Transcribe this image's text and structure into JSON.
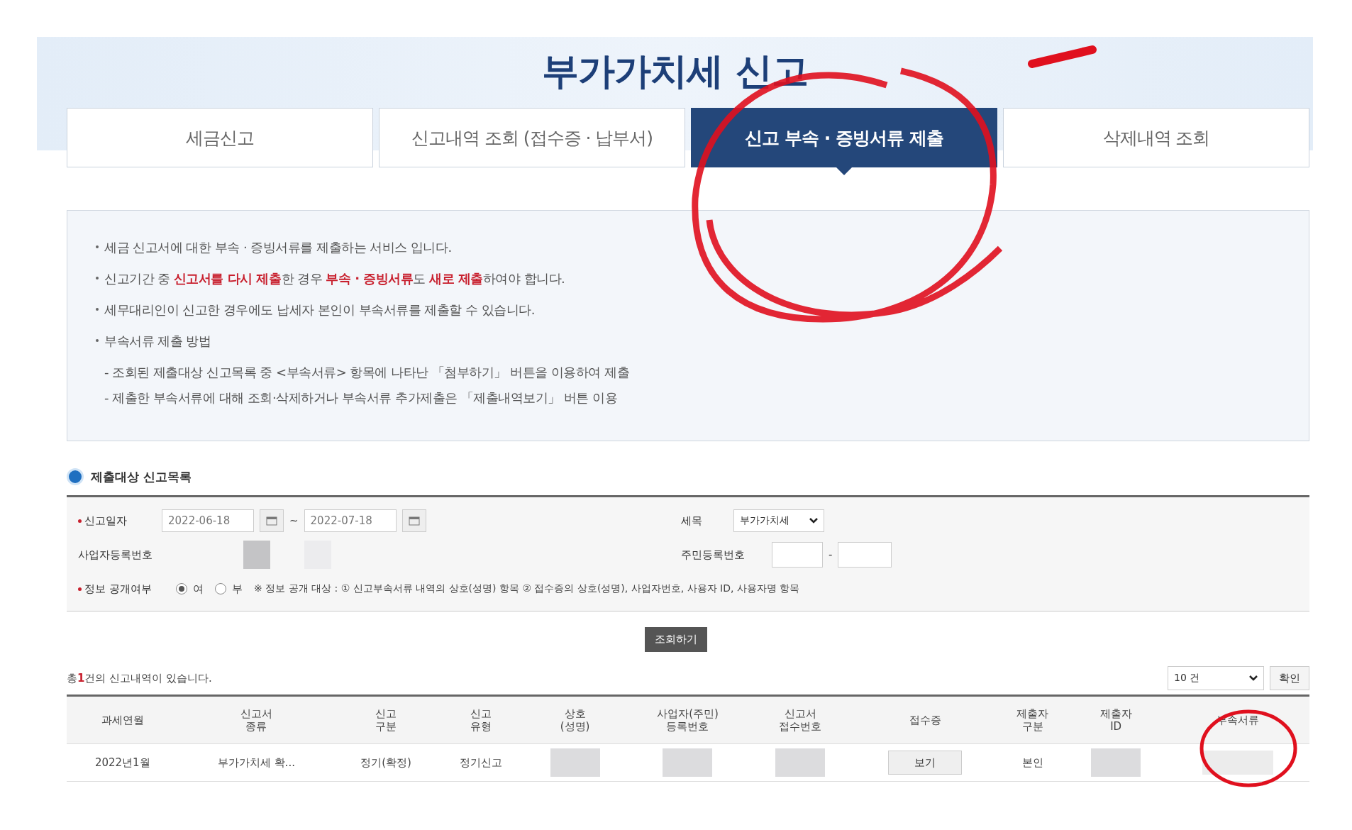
{
  "header": {
    "title": "부가가치세 신고"
  },
  "tabs": [
    {
      "label": "세금신고",
      "selected": false
    },
    {
      "label": "신고내역 조회 (접수증 · 납부서)",
      "selected": false
    },
    {
      "label": "신고 부속 · 증빙서류 제출",
      "selected": true
    },
    {
      "label": "삭제내역 조회",
      "selected": false
    }
  ],
  "notice": {
    "items": [
      "세금 신고서에 대한 부속 · 증빙서류를 제출하는 서비스 입니다.",
      "신고기간 중 **신고서를 다시 제출**한 경우 **부속 · 증빙서류**도 **새로 제출**하여야 합니다.",
      "세무대리인이 신고한 경우에도 납세자 본인이 부속서류를 제출할 수 있습니다.",
      "부속서류 제출 방법"
    ],
    "sub_items": [
      "- 조회된 제출대상 신고목록 중 <부속서류> 항목에 나타난 「첨부하기」 버튼을 이용하여 제출",
      "- 제출한 부속서류에 대해 조회·삭제하거나 부속서류 추가제출은 「제출내역보기」 버튼 이용"
    ]
  },
  "section_title": "제출대상 신고목록",
  "search": {
    "date_label": "신고일자",
    "date_from": "2022-06-18",
    "date_sep": "~",
    "date_to": "2022-07-18",
    "tax_label": "세목",
    "tax_value": "부가가치세",
    "biz_label": "사업자등록번호",
    "rrn_label": "주민등록번호",
    "rrn_sep": "-",
    "public_label": "정보 공개여부",
    "public_options": [
      {
        "label": "여",
        "selected": true
      },
      {
        "label": "부",
        "selected": false
      }
    ],
    "public_note": "※ 정보 공개 대상 : ① 신고부속서류 내역의 상호(성명) 항목 ② 접수증의 상호(성명), 사업자번호, 사용자 ID, 사용자명 항목",
    "button": "조회하기"
  },
  "result": {
    "count_prefix": "총",
    "count": "1",
    "count_suffix": "건의 신고내역이 있습니다.",
    "page_size": "10 건",
    "confirm": "확인",
    "columns": [
      "과세연월",
      "신고서\n종류",
      "신고\n구분",
      "신고\n유형",
      "상호\n(성명)",
      "사업자(주민)\n등록번호",
      "신고서\n접수번호",
      "접수증",
      "제출자\n구분",
      "제출자\nID",
      "부속서류"
    ],
    "rows": [
      {
        "cells": [
          {
            "kind": "text",
            "text": "2022년1월"
          },
          {
            "kind": "text",
            "text": "부가가치세 확..."
          },
          {
            "kind": "text",
            "text": "정기(확정)"
          },
          {
            "kind": "text",
            "text": "정기신고"
          },
          {
            "kind": "redacted"
          },
          {
            "kind": "redacted"
          },
          {
            "kind": "redacted"
          },
          {
            "kind": "button",
            "text": "보기"
          },
          {
            "kind": "text",
            "text": "본인"
          },
          {
            "kind": "redacted"
          },
          {
            "kind": "blank_button"
          }
        ]
      }
    ]
  }
}
